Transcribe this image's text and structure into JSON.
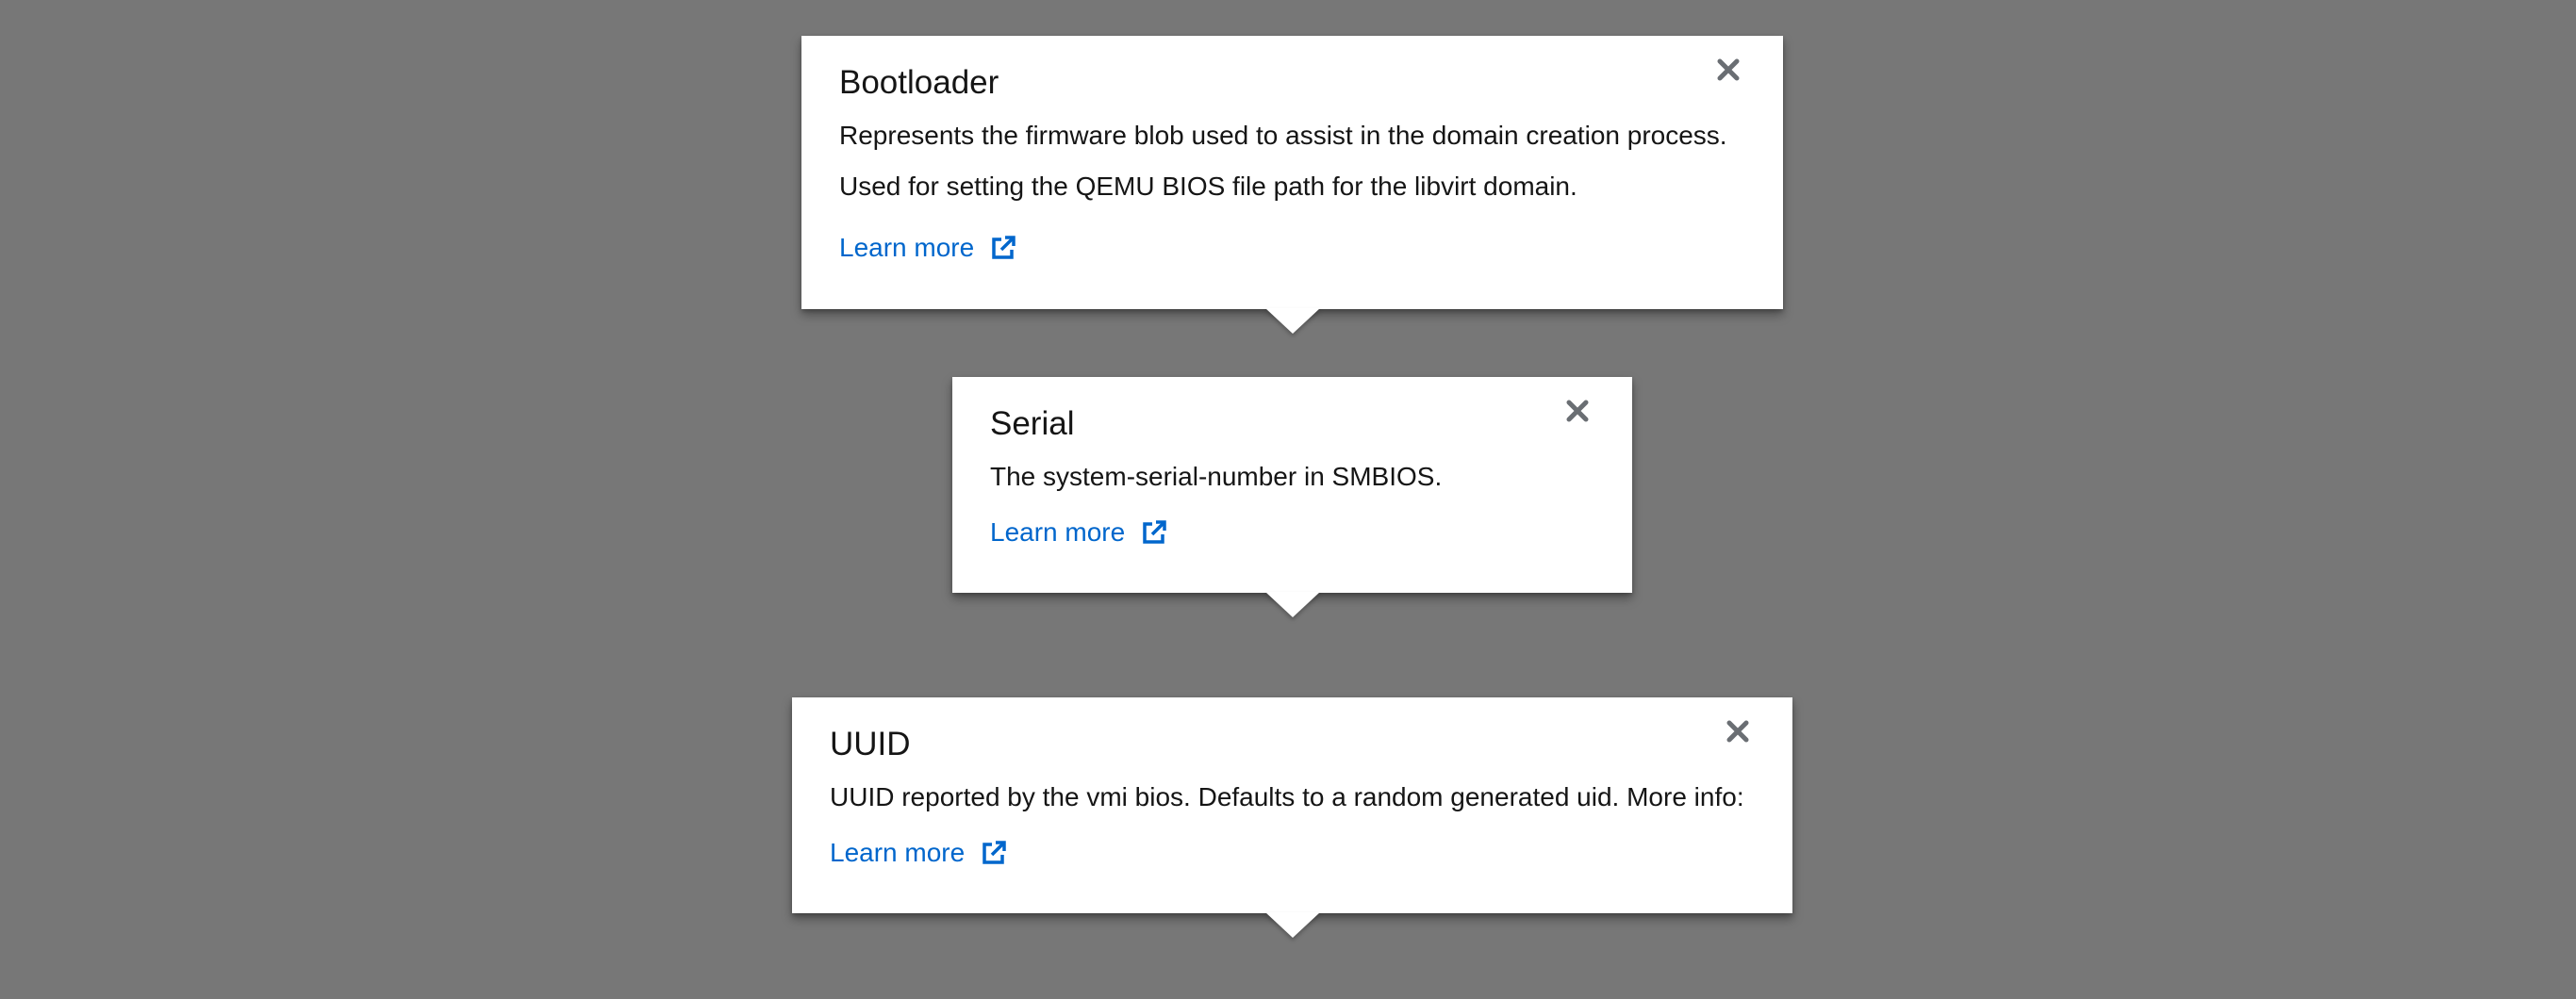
{
  "popovers": {
    "bootloader": {
      "title": "Bootloader",
      "description_lines": [
        "Represents the firmware blob used to assist in the domain creation process.",
        "Used for setting the QEMU BIOS file path for the libvirt domain."
      ],
      "link_label": "Learn more",
      "close_icon": "close-icon",
      "link_icon": "external-link-icon"
    },
    "serial": {
      "title": "Serial",
      "description_lines": [
        "The system-serial-number in SMBIOS."
      ],
      "link_label": "Learn more",
      "close_icon": "close-icon",
      "link_icon": "external-link-icon"
    },
    "uuid": {
      "title": "UUID",
      "description_lines": [
        "UUID reported by the vmi bios. Defaults to a random generated uid. More info:"
      ],
      "link_label": "Learn more",
      "close_icon": "close-icon",
      "link_icon": "external-link-icon"
    }
  },
  "colors": {
    "backdrop": "#777777",
    "popover_bg": "#ffffff",
    "text": "#151515",
    "link": "#0066cc",
    "close_icon": "#6a6e73"
  }
}
